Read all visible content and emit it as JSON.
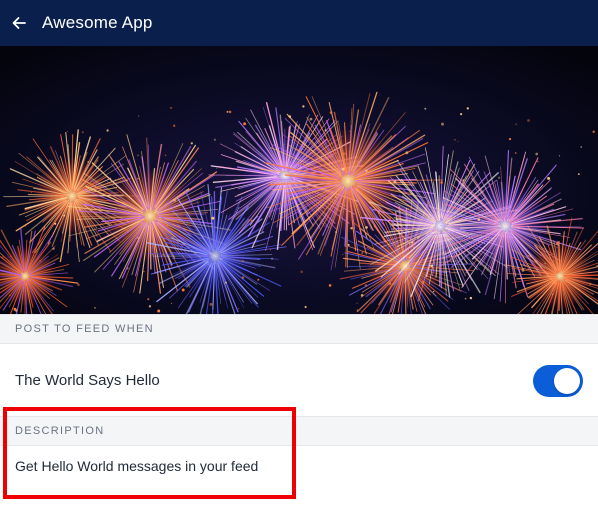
{
  "header": {
    "title": "Awesome App",
    "background": "#0b1f4d",
    "back_icon": "arrow-left-icon"
  },
  "hero": {
    "image": "fireworks-photo",
    "colors": [
      "#ff8a3d",
      "#ffd27a",
      "#6b63ff",
      "#c56bff",
      "#3b5bff"
    ]
  },
  "post_section": {
    "header": "POST TO FEED WHEN",
    "items": [
      {
        "label": "The World Says Hello",
        "toggle_on": true
      }
    ]
  },
  "description_section": {
    "header": "DESCRIPTION",
    "text": "Get Hello World messages in your feed"
  },
  "colors": {
    "toggle_on": "#0b5ed7",
    "highlight": "#ee0000",
    "section_bg": "#f4f5f7"
  }
}
